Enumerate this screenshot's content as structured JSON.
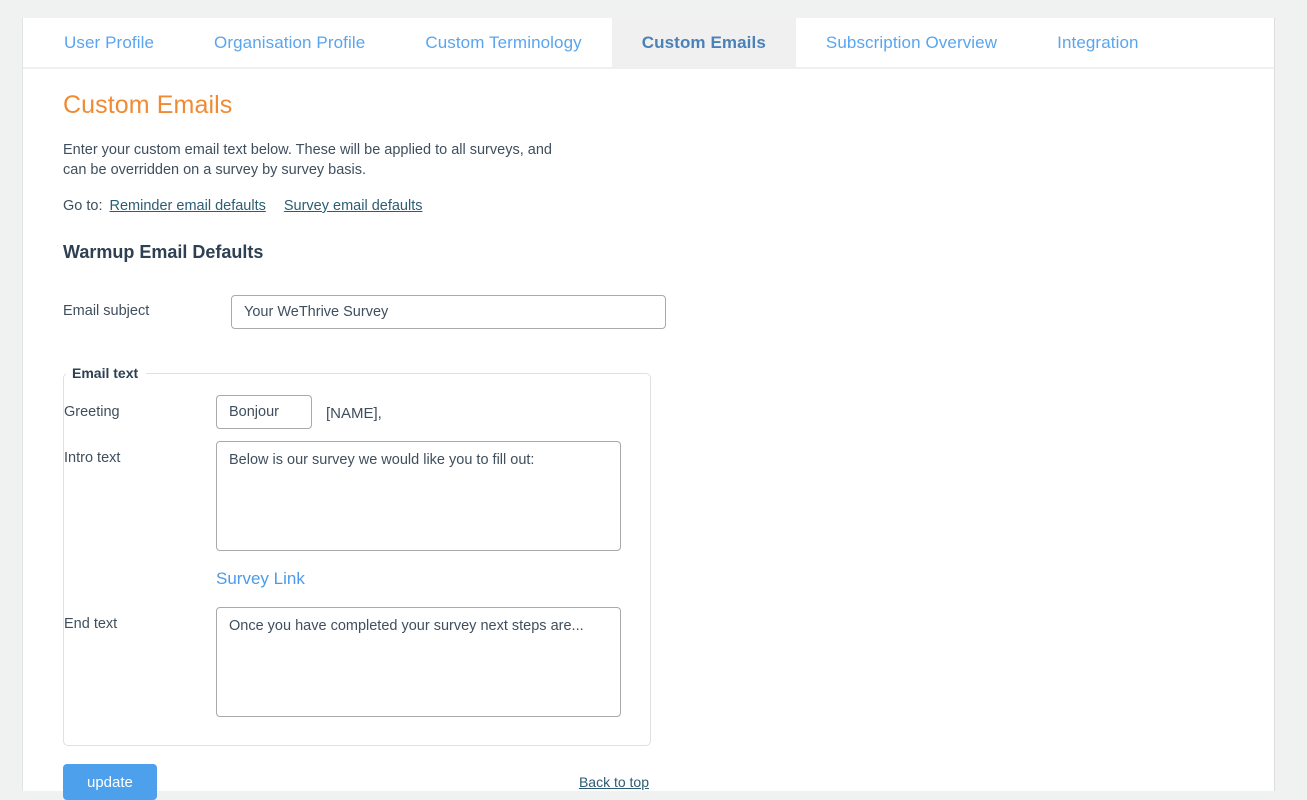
{
  "tabs": [
    {
      "label": "User Profile",
      "active": false
    },
    {
      "label": "Organisation Profile",
      "active": false
    },
    {
      "label": "Custom Terminology",
      "active": false
    },
    {
      "label": "Custom Emails",
      "active": true
    },
    {
      "label": "Subscription Overview",
      "active": false
    },
    {
      "label": "Integration",
      "active": false
    }
  ],
  "page": {
    "title": "Custom Emails",
    "intro": "Enter your custom email text below. These will be applied to all surveys, and can be overridden on a survey by survey basis.",
    "goto_label": "Go to:",
    "goto_links": [
      "Reminder email defaults",
      "Survey email defaults"
    ]
  },
  "warmup": {
    "section_title": "Warmup Email Defaults",
    "subject": {
      "label": "Email subject",
      "value": "Your WeThrive Survey",
      "placeholder": ""
    },
    "fieldset_legend": "Email text",
    "greeting": {
      "label": "Greeting",
      "value": "Bonjour",
      "suffix": "[NAME],"
    },
    "intro_text": {
      "label": "Intro text",
      "value": "Below is our survey we would like you to fill out:"
    },
    "survey_link": "Survey Link",
    "end_text": {
      "label": "End text",
      "value": "Once you have completed your survey next steps are..."
    }
  },
  "footer": {
    "update_label": "update",
    "back_to_top_label": "Back to top"
  },
  "colors": {
    "accent_orange": "#f08a33",
    "tab_blue": "#59a5ef",
    "active_tab_blue": "#4a82b8",
    "button_blue": "#4da1ec",
    "link_teal": "#2c5d74",
    "heading_slate": "#2e4052",
    "page_background": "#f0f1f1"
  }
}
